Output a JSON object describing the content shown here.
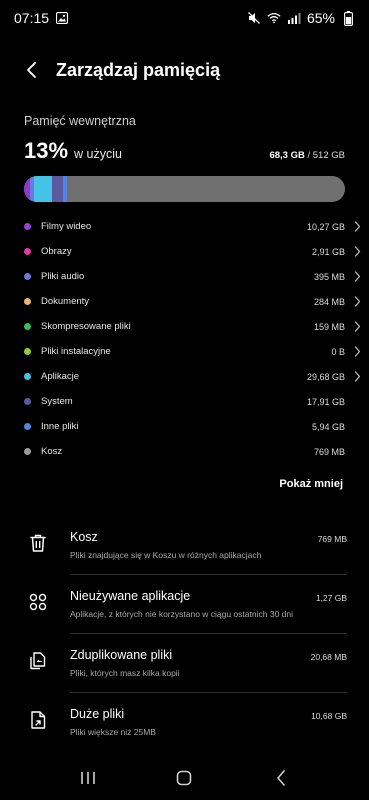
{
  "status": {
    "time": "07:15",
    "battery": "65%"
  },
  "header": {
    "title": "Zarządzaj pamięcią"
  },
  "storage": {
    "label": "Pamięć wewnętrzna",
    "percent": "13%",
    "used_word": "w użyciu",
    "used": "68,3 GB",
    "total": "/ 512 GB",
    "used_fraction": 0.13
  },
  "bar_segments": [
    {
      "color": "#8a3bc9",
      "fraction": 0.02
    },
    {
      "color": "#6e79e0",
      "fraction": 0.01
    },
    {
      "color": "#45c2e8",
      "fraction": 0.058
    },
    {
      "color": "#5a5aa0",
      "fraction": 0.035
    },
    {
      "color": "#4f86e6",
      "fraction": 0.012
    }
  ],
  "categories": [
    {
      "name": "Filmy wideo",
      "size": "10,27 GB",
      "color": "#9b3fd6",
      "chevron": true
    },
    {
      "name": "Obrazy",
      "size": "2,91 GB",
      "color": "#e63aa0",
      "chevron": true
    },
    {
      "name": "Pliki audio",
      "size": "395 MB",
      "color": "#6e79e0",
      "chevron": true
    },
    {
      "name": "Dokumenty",
      "size": "284 MB",
      "color": "#e8b56a",
      "chevron": true
    },
    {
      "name": "Skompresowane pliki",
      "size": "159 MB",
      "color": "#3dbb5a",
      "chevron": true
    },
    {
      "name": "Pliki instalacyjne",
      "size": "0 B",
      "color": "#8fcf2e",
      "chevron": true
    },
    {
      "name": "Aplikacje",
      "size": "29,68 GB",
      "color": "#45c2e8",
      "chevron": true
    },
    {
      "name": "System",
      "size": "17,91 GB",
      "color": "#5a5aa0",
      "chevron": false
    },
    {
      "name": "Inne pliki",
      "size": "5,94 GB",
      "color": "#4f86e6",
      "chevron": false
    },
    {
      "name": "Kosz",
      "size": "769 MB",
      "color": "#9a9a9a",
      "chevron": false
    }
  ],
  "show_less": "Pokaż mniej",
  "tools": [
    {
      "title": "Kosz",
      "subtitle": "Pliki znajdujące się w Koszu w różnych aplikacjach",
      "size": "769 MB",
      "icon": "trash-icon"
    },
    {
      "title": "Nieużywane aplikacje",
      "subtitle": "Aplikacje, z których nie korzystano w ciągu ostatnich 30 dni",
      "size": "1,27 GB",
      "icon": "apps-grid-icon"
    },
    {
      "title": "Zduplikowane pliki",
      "subtitle": "Pliki, których masz kilka kopii",
      "size": "20,68 MB",
      "icon": "duplicate-files-icon"
    },
    {
      "title": "Duże pliki",
      "subtitle": "Pliki większe niż 25MB",
      "size": "10,68 GB",
      "icon": "large-file-icon"
    }
  ]
}
